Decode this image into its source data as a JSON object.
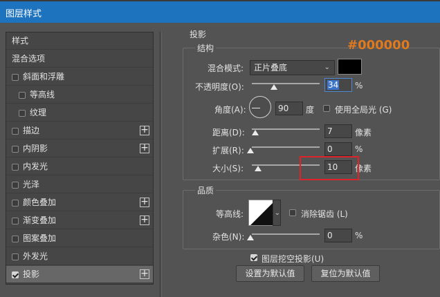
{
  "window": {
    "title": "图层样式"
  },
  "left": {
    "items": [
      {
        "label": "样式",
        "checkbox": false,
        "plus": false
      },
      {
        "label": "混合选项",
        "checkbox": false,
        "plus": false
      },
      {
        "label": "斜面和浮雕",
        "checkbox": true,
        "checked": false,
        "plus": false
      },
      {
        "label": "等高线",
        "checkbox": true,
        "checked": false,
        "plus": false,
        "indent": true
      },
      {
        "label": "纹理",
        "checkbox": true,
        "checked": false,
        "plus": false,
        "indent": true
      },
      {
        "label": "描边",
        "checkbox": true,
        "checked": false,
        "plus": true
      },
      {
        "label": "内阴影",
        "checkbox": true,
        "checked": false,
        "plus": true
      },
      {
        "label": "内发光",
        "checkbox": true,
        "checked": false,
        "plus": false
      },
      {
        "label": "光泽",
        "checkbox": true,
        "checked": false,
        "plus": false
      },
      {
        "label": "颜色叠加",
        "checkbox": true,
        "checked": false,
        "plus": true
      },
      {
        "label": "渐变叠加",
        "checkbox": true,
        "checked": false,
        "plus": true
      },
      {
        "label": "图案叠加",
        "checkbox": true,
        "checked": false,
        "plus": false
      },
      {
        "label": "外发光",
        "checkbox": true,
        "checked": false,
        "plus": false
      },
      {
        "label": "投影",
        "checkbox": true,
        "checked": true,
        "plus": true,
        "selected": true
      }
    ]
  },
  "shadow": {
    "section_title": "投影",
    "structure_title": "结构",
    "blend_mode_label": "混合模式:",
    "blend_mode_value": "正片叠底",
    "color": "#000000",
    "color_annotation": "#000000",
    "opacity_label": "不透明度(O):",
    "opacity_value": "34",
    "opacity_unit": "%",
    "angle_label": "角度(A):",
    "angle_value": "90",
    "angle_unit": "度",
    "global_light_label": "使用全局光 (G)",
    "distance_label": "距离(D):",
    "distance_value": "7",
    "distance_unit": "像素",
    "spread_label": "扩展(R):",
    "spread_value": "0",
    "spread_unit": "%",
    "size_label": "大小(S):",
    "size_value": "10",
    "size_unit": "像素",
    "quality_title": "品质",
    "contour_label": "等高线:",
    "antialias_label": "消除锯齿 (L)",
    "noise_label": "杂色(N):",
    "noise_value": "0",
    "noise_unit": "%",
    "knockout_label": "图层挖空投影(U)",
    "set_default_label": "设置为默认值",
    "reset_default_label": "复位为默认值"
  }
}
